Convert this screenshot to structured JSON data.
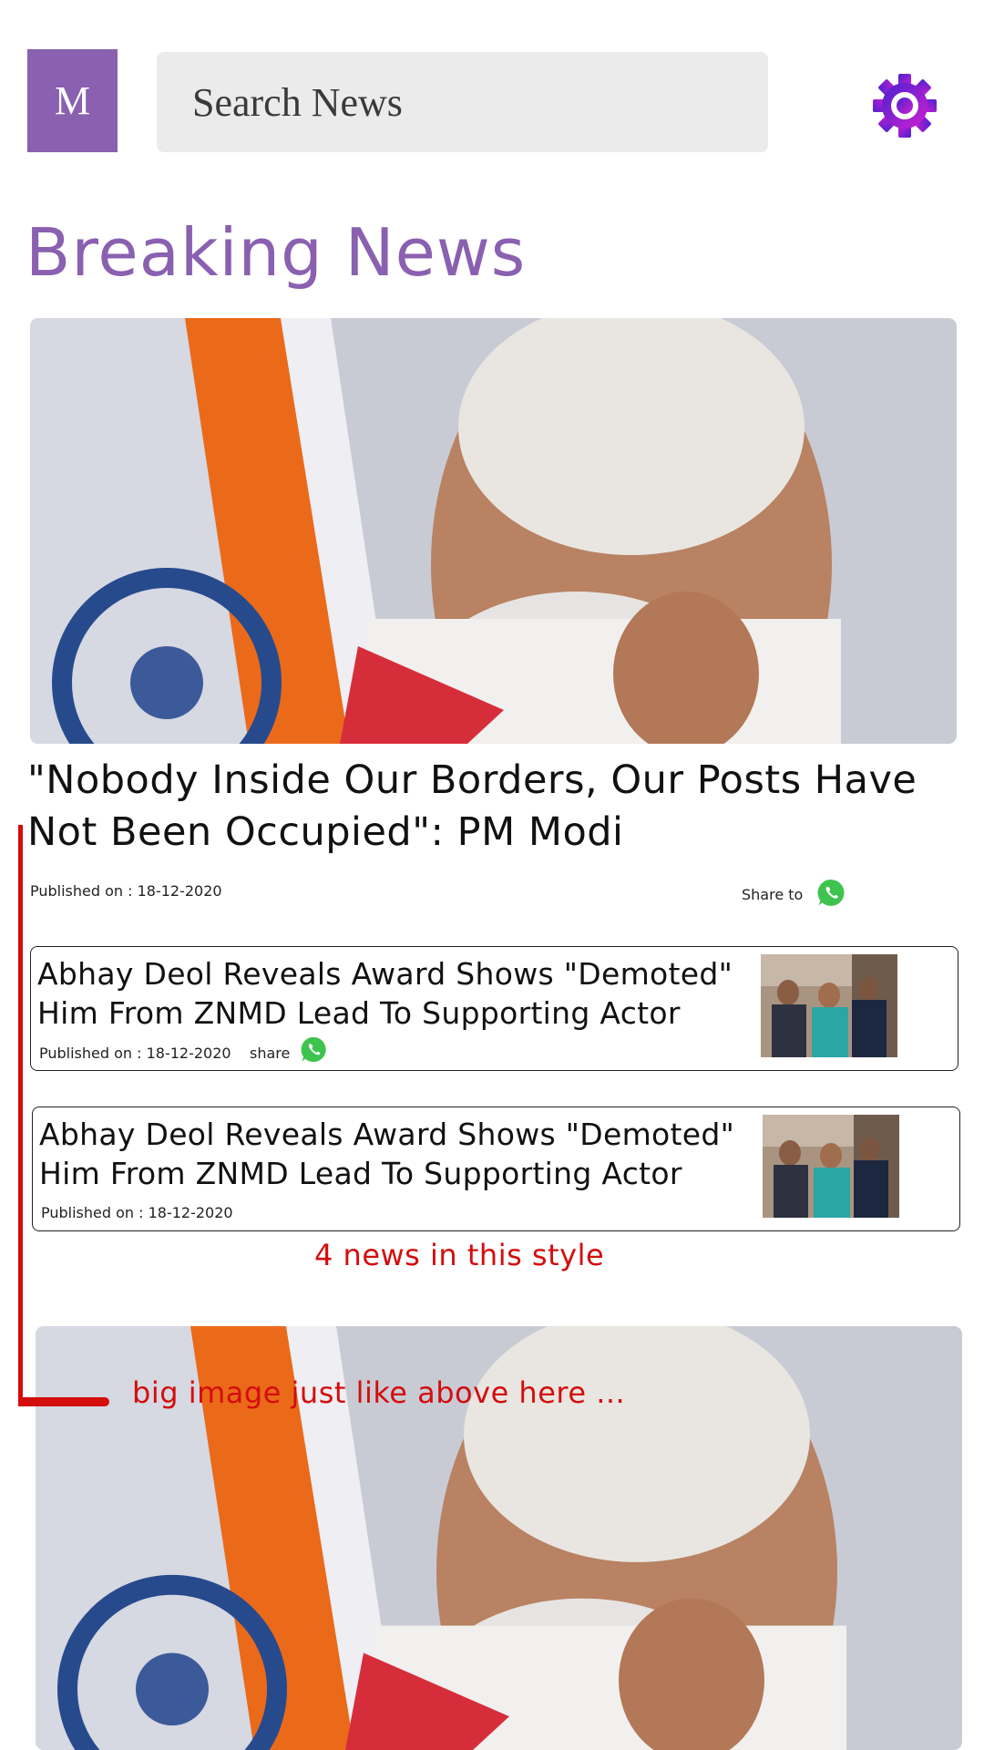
{
  "header": {
    "logo_letter": "M",
    "search_placeholder": "Search News",
    "settings_icon": "gear-icon"
  },
  "section": {
    "title": "Breaking News"
  },
  "hero": {
    "headline": "\"Nobody Inside Our Borders, Our Posts Have Not Been Occupied\": PM Modi",
    "published": "Published on : 18-12-2020",
    "share_label": "Share to",
    "share_icon": "whatsapp-icon"
  },
  "list": [
    {
      "title": "Abhay Deol Reveals Award Shows \"Demoted\" Him From ZNMD Lead To Supporting Actor",
      "published": "Published on : 18-12-2020",
      "share_label": "share",
      "share_icon": "whatsapp-icon"
    },
    {
      "title": "Abhay Deol Reveals Award Shows \"Demoted\" Him From ZNMD Lead To Supporting Actor",
      "published": "Published on : 18-12-2020"
    }
  ],
  "annotations": {
    "list_note": "4 news in this style",
    "image_note": "big image just like above here ..."
  },
  "colors": {
    "accent": "#8a60b0",
    "search_bg": "#ebebeb",
    "annotation": "#d40d0d",
    "whatsapp": "#3fc34f",
    "gear_start": "#6b2bd6",
    "gear_end": "#c21ad1"
  }
}
